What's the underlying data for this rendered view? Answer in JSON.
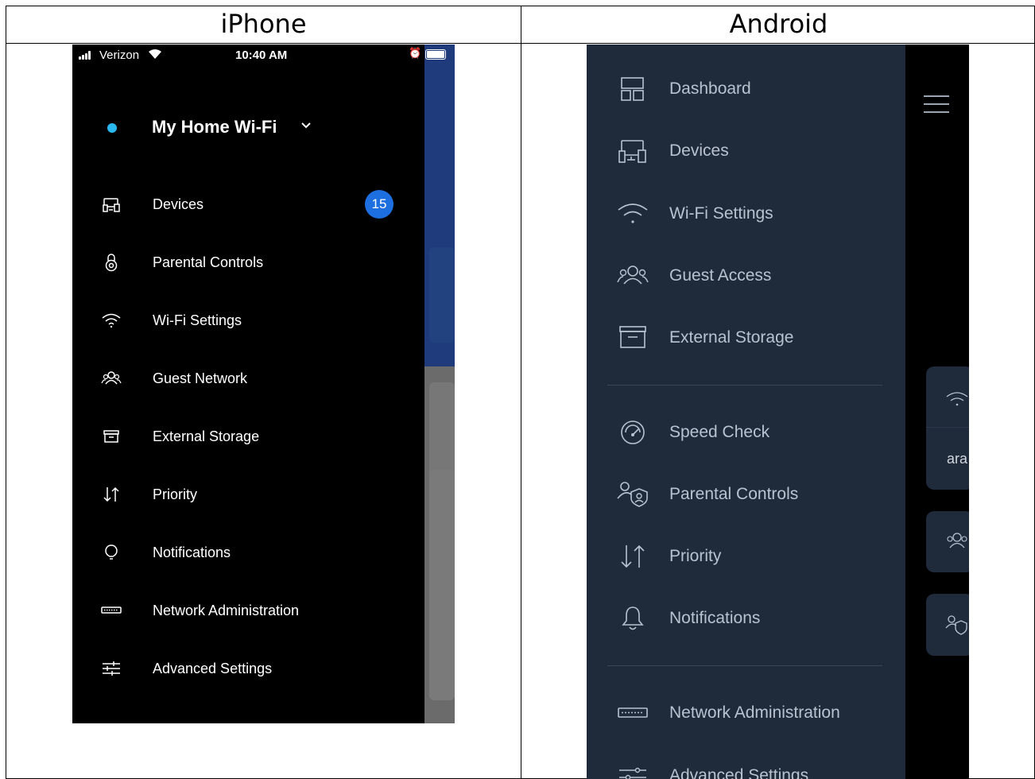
{
  "headers": {
    "left": "iPhone",
    "right": "Android"
  },
  "iphone": {
    "status": {
      "carrier": "Verizon",
      "time": "10:40 AM"
    },
    "network_name": "My Home Wi-Fi",
    "devices_badge": "15",
    "menu": [
      {
        "label": "Devices",
        "icon": "devices-icon"
      },
      {
        "label": "Parental Controls",
        "icon": "lock-icon"
      },
      {
        "label": "Wi-Fi Settings",
        "icon": "wifi-icon"
      },
      {
        "label": "Guest Network",
        "icon": "guests-icon"
      },
      {
        "label": "External Storage",
        "icon": "storage-icon"
      },
      {
        "label": "Priority",
        "icon": "priority-icon"
      },
      {
        "label": "Notifications",
        "icon": "bell-icon"
      },
      {
        "label": "Network Administration",
        "icon": "router-icon"
      },
      {
        "label": "Advanced Settings",
        "icon": "sliders-icon"
      }
    ]
  },
  "android": {
    "menu": [
      {
        "label": "Dashboard",
        "icon": "dashboard-icon"
      },
      {
        "label": "Devices",
        "icon": "devices-icon"
      },
      {
        "label": "Wi-Fi Settings",
        "icon": "wifi-icon"
      },
      {
        "label": "Guest Access",
        "icon": "guests-icon"
      },
      {
        "label": "External Storage",
        "icon": "storage-icon"
      },
      {
        "label": "Speed Check",
        "icon": "speedometer-icon"
      },
      {
        "label": "Parental Controls",
        "icon": "parental-shield-icon"
      },
      {
        "label": "Priority",
        "icon": "priority-icon"
      },
      {
        "label": "Notifications",
        "icon": "bell-icon"
      },
      {
        "label": "Network Administration",
        "icon": "router-icon"
      },
      {
        "label": "Advanced Settings",
        "icon": "sliders-icon"
      }
    ],
    "card_text": "ara"
  },
  "colors": {
    "iphone_drawer": "#000000",
    "iphone_accent": "#1d6fe0",
    "status_dot": "#29b8f0",
    "android_drawer": "#1f2a3b",
    "android_text": "#b9c2cf"
  }
}
